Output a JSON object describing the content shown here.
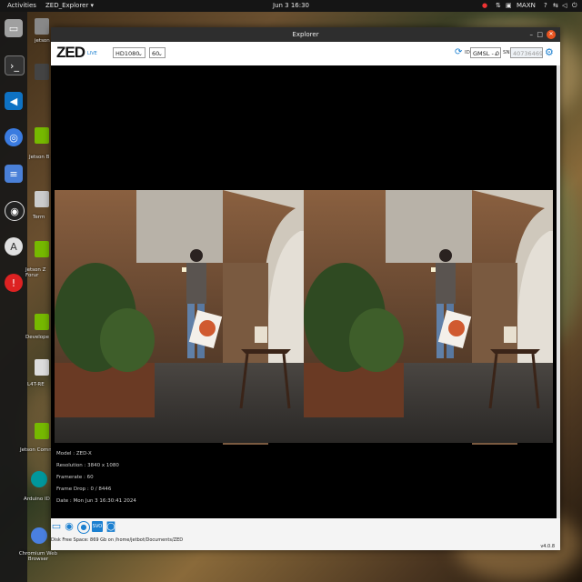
{
  "topbar": {
    "activities": "Activities",
    "app_menu": "ZED_Explorer ▾",
    "clock": "Jun 3 16:30",
    "power_mode": "MAXN"
  },
  "dock": {
    "icons": [
      "files-icon",
      "terminal-icon",
      "vscode-icon",
      "chromium-icon",
      "text-editor-icon",
      "obs-icon",
      "software-icon",
      "help-icon"
    ]
  },
  "desktop": {
    "items": [
      "jetson",
      "Term",
      "Jetson B",
      "Jetson Z Forur",
      "Develope",
      "L4T-RE",
      "Jetson Communi",
      "Arduino ID",
      "Chromium Web Browser"
    ]
  },
  "window": {
    "title": "Explorer",
    "logo": "ZED",
    "live_label": "LIVE",
    "resolution_select": "HD1080",
    "fps_select": "60",
    "id_label": "ID",
    "camera_select": "GMSL - 0",
    "sn_label": "SN",
    "sn_value": "40736469"
  },
  "camera_info": {
    "model": "Model : ZED-X",
    "resolution": "Resolution : 3840 x 1080",
    "framerate": "Framerate : 60",
    "frame_drop": "Frame Drop : 0 / 8446",
    "date": "Date : Mon Jun 3 16:30:41 2024"
  },
  "status": {
    "disk": "Disk Free Space: 869 Gb on /home/jetbot/Documents/ZED",
    "version": "v4.0.8"
  },
  "colors": {
    "accent": "#1a7fd0",
    "titlebar": "#2e2e2e",
    "topbar": "#151515"
  }
}
